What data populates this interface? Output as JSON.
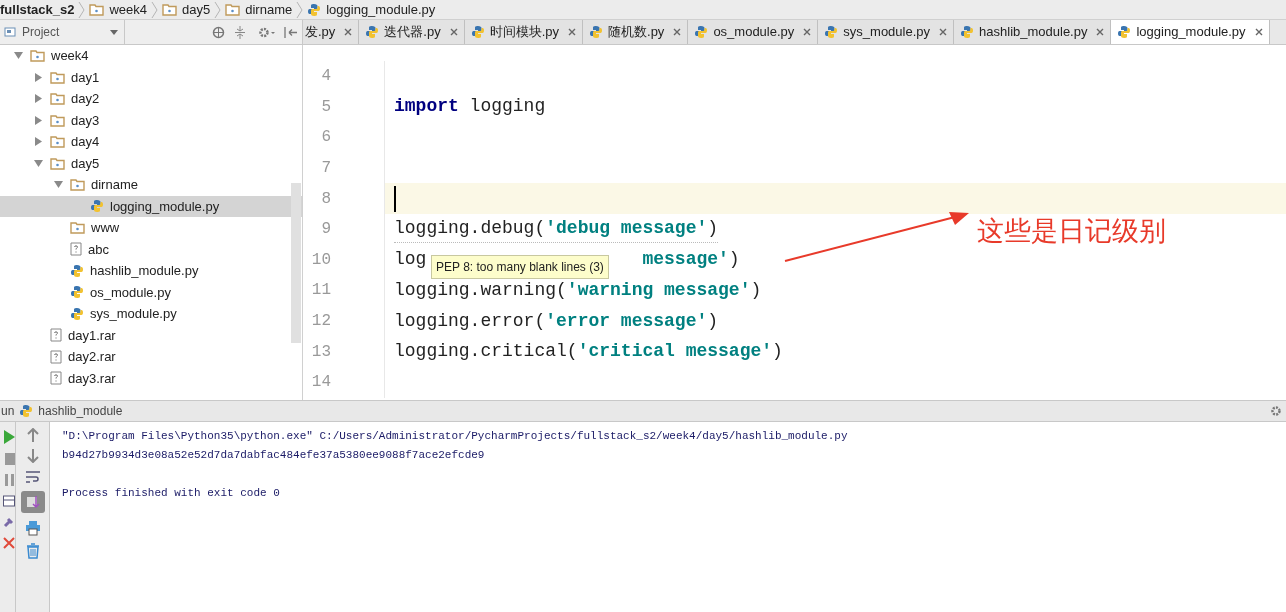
{
  "breadcrumbs": [
    {
      "label": "fullstack_s2",
      "kind": "project"
    },
    {
      "label": "week4",
      "kind": "folder"
    },
    {
      "label": "day5",
      "kind": "folder"
    },
    {
      "label": "dirname",
      "kind": "folder"
    },
    {
      "label": "logging_module.py",
      "kind": "python"
    }
  ],
  "project_panel": {
    "title": "Project",
    "tree": [
      {
        "label": "week4",
        "kind": "folder",
        "expanded": true,
        "selected": false,
        "children": [
          {
            "label": "day1",
            "kind": "folder",
            "expanded": false,
            "selected": false
          },
          {
            "label": "day2",
            "kind": "folder",
            "expanded": false,
            "selected": false
          },
          {
            "label": "day3",
            "kind": "folder",
            "expanded": false,
            "selected": false
          },
          {
            "label": "day4",
            "kind": "folder",
            "expanded": false,
            "selected": false
          },
          {
            "label": "day5",
            "kind": "folder",
            "expanded": true,
            "selected": false,
            "children": [
              {
                "label": "dirname",
                "kind": "folder",
                "expanded": true,
                "selected": false,
                "children": [
                  {
                    "label": "logging_module.py",
                    "kind": "python",
                    "selected": true
                  }
                ]
              },
              {
                "label": "www",
                "kind": "folder",
                "selected": false
              },
              {
                "label": "abc",
                "kind": "file",
                "selected": false
              },
              {
                "label": "hashlib_module.py",
                "kind": "python",
                "selected": false
              },
              {
                "label": "os_module.py",
                "kind": "python",
                "selected": false
              },
              {
                "label": "sys_module.py",
                "kind": "python",
                "selected": false
              }
            ]
          },
          {
            "label": "day1.rar",
            "kind": "file",
            "selected": false
          },
          {
            "label": "day2.rar",
            "kind": "file",
            "selected": false
          },
          {
            "label": "day3.rar",
            "kind": "file",
            "selected": false
          }
        ]
      }
    ]
  },
  "editor_tabs": [
    {
      "label": "发.py",
      "selected": false
    },
    {
      "label": "迭代器.py",
      "selected": false
    },
    {
      "label": "时间模块.py",
      "selected": false
    },
    {
      "label": "随机数.py",
      "selected": false
    },
    {
      "label": "os_module.py",
      "selected": false
    },
    {
      "label": "sys_module.py",
      "selected": false
    },
    {
      "label": "hashlib_module.py",
      "selected": false
    },
    {
      "label": "logging_module.py",
      "selected": true
    }
  ],
  "editor": {
    "lines": [
      {
        "number": "4"
      },
      {
        "number": "5",
        "parts": [
          {
            "text": "import",
            "kind": "keyword"
          },
          {
            "text": " logging",
            "kind": "plain"
          }
        ]
      },
      {
        "number": "6"
      },
      {
        "number": "7"
      },
      {
        "number": "8",
        "current": true
      },
      {
        "number": "9",
        "parts": [
          {
            "text": "logging.debug(",
            "kind": "plain"
          },
          {
            "text": "'debug message'",
            "kind": "string"
          },
          {
            "text": ")",
            "kind": "plain"
          }
        ],
        "warning": true
      },
      {
        "number": "10",
        "parts": [
          {
            "text": "log",
            "kind": "plain"
          },
          {
            "text": "message'",
            "kind": "string"
          },
          {
            "text": ")",
            "kind": "plain"
          }
        ],
        "covered": true
      },
      {
        "number": "11",
        "parts": [
          {
            "text": "logging.warning(",
            "kind": "plain"
          },
          {
            "text": "'warning message'",
            "kind": "string"
          },
          {
            "text": ")",
            "kind": "plain"
          }
        ]
      },
      {
        "number": "12",
        "parts": [
          {
            "text": "logging.error(",
            "kind": "plain"
          },
          {
            "text": "'error message'",
            "kind": "string"
          },
          {
            "text": ")",
            "kind": "plain"
          }
        ]
      },
      {
        "number": "13",
        "parts": [
          {
            "text": "logging.critical(",
            "kind": "plain"
          },
          {
            "text": "'critical message'",
            "kind": "string"
          },
          {
            "text": ")",
            "kind": "plain"
          }
        ]
      },
      {
        "number": "14"
      }
    ],
    "tooltip": "PEP 8: too many blank lines (3)",
    "annotation": "这些是日记级别"
  },
  "run_panel": {
    "title": "un",
    "config": "hashlib_module",
    "output": [
      {
        "text": "\"D:\\Program Files\\Python35\\python.exe\" C:/Users/Administrator/PycharmProjects/fullstack_s2/week4/day5/hashlib_module.py"
      },
      {
        "text": "b94d27b9934d3e08a52e52d7da7dabfac484efe37a5380ee9088f7ace2efcde9"
      },
      {
        "text": "Process finished with exit code 0",
        "kind": "status"
      }
    ],
    "scroll_to_end": true
  }
}
